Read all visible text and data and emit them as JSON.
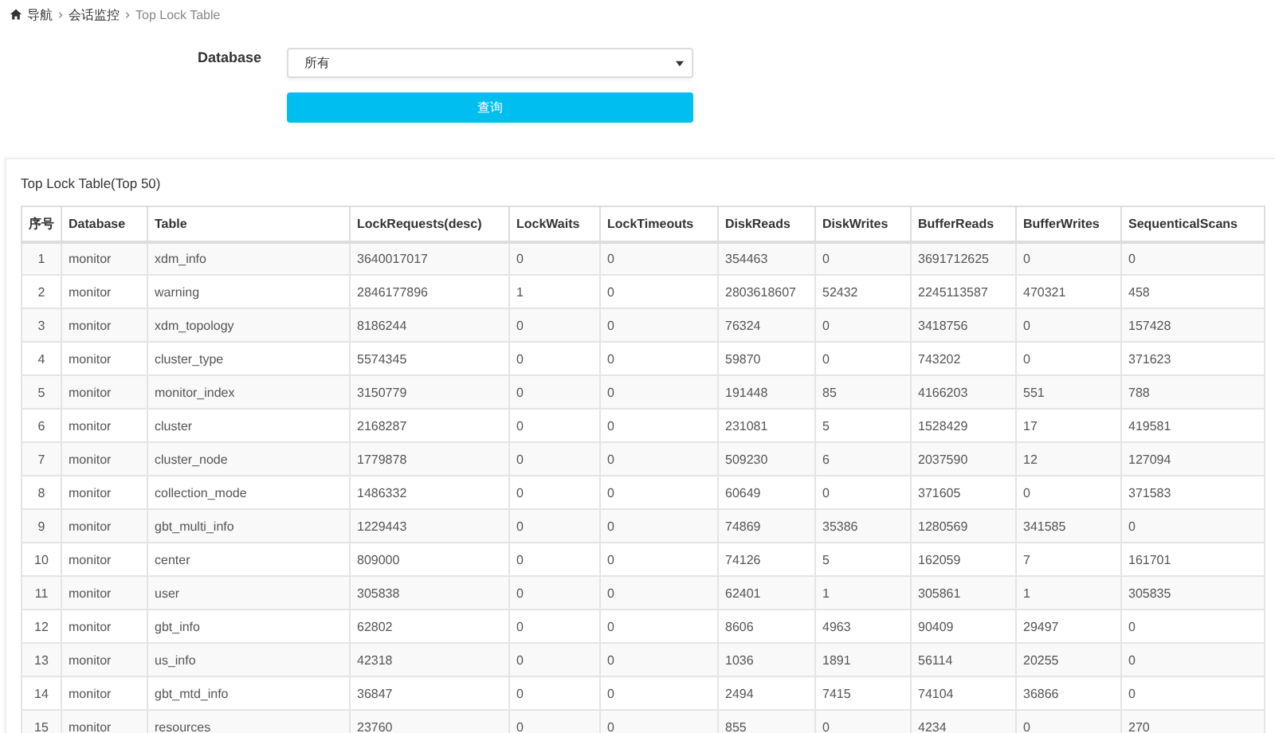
{
  "breadcrumb": [
    {
      "label": "导航",
      "kind": "home"
    },
    {
      "label": "会话监控",
      "kind": "link"
    },
    {
      "label": "Top Lock Table",
      "kind": "current"
    }
  ],
  "form": {
    "label": "Database",
    "select_value": "所有",
    "button": "查询"
  },
  "panel": {
    "title": "Top Lock Table(Top 50)"
  },
  "table": {
    "columns": [
      "序号",
      "Database",
      "Table",
      "LockRequests(desc)",
      "LockWaits",
      "LockTimeouts",
      "DiskReads",
      "DiskWrites",
      "BufferReads",
      "BufferWrites",
      "SequenticalScans"
    ],
    "rows": [
      [
        "1",
        "monitor",
        "xdm_info",
        "3640017017",
        "0",
        "0",
        "354463",
        "0",
        "3691712625",
        "0",
        "0"
      ],
      [
        "2",
        "monitor",
        "warning",
        "2846177896",
        "1",
        "0",
        "2803618607",
        "52432",
        "2245113587",
        "470321",
        "458"
      ],
      [
        "3",
        "monitor",
        "xdm_topology",
        "8186244",
        "0",
        "0",
        "76324",
        "0",
        "3418756",
        "0",
        "157428"
      ],
      [
        "4",
        "monitor",
        "cluster_type",
        "5574345",
        "0",
        "0",
        "59870",
        "0",
        "743202",
        "0",
        "371623"
      ],
      [
        "5",
        "monitor",
        "monitor_index",
        "3150779",
        "0",
        "0",
        "191448",
        "85",
        "4166203",
        "551",
        "788"
      ],
      [
        "6",
        "monitor",
        "cluster",
        "2168287",
        "0",
        "0",
        "231081",
        "5",
        "1528429",
        "17",
        "419581"
      ],
      [
        "7",
        "monitor",
        "cluster_node",
        "1779878",
        "0",
        "0",
        "509230",
        "6",
        "2037590",
        "12",
        "127094"
      ],
      [
        "8",
        "monitor",
        "collection_mode",
        "1486332",
        "0",
        "0",
        "60649",
        "0",
        "371605",
        "0",
        "371583"
      ],
      [
        "9",
        "monitor",
        "gbt_multi_info",
        "1229443",
        "0",
        "0",
        "74869",
        "35386",
        "1280569",
        "341585",
        "0"
      ],
      [
        "10",
        "monitor",
        "center",
        "809000",
        "0",
        "0",
        "74126",
        "5",
        "162059",
        "7",
        "161701"
      ],
      [
        "11",
        "monitor",
        "user",
        "305838",
        "0",
        "0",
        "62401",
        "1",
        "305861",
        "1",
        "305835"
      ],
      [
        "12",
        "monitor",
        "gbt_info",
        "62802",
        "0",
        "0",
        "8606",
        "4963",
        "90409",
        "29497",
        "0"
      ],
      [
        "13",
        "monitor",
        "us_info",
        "42318",
        "0",
        "0",
        "1036",
        "1891",
        "56114",
        "20255",
        "0"
      ],
      [
        "14",
        "monitor",
        "gbt_mtd_info",
        "36847",
        "0",
        "0",
        "2494",
        "7415",
        "74104",
        "36866",
        "0"
      ],
      [
        "15",
        "monitor",
        "resources",
        "23760",
        "0",
        "0",
        "855",
        "0",
        "4234",
        "0",
        "270"
      ]
    ]
  }
}
